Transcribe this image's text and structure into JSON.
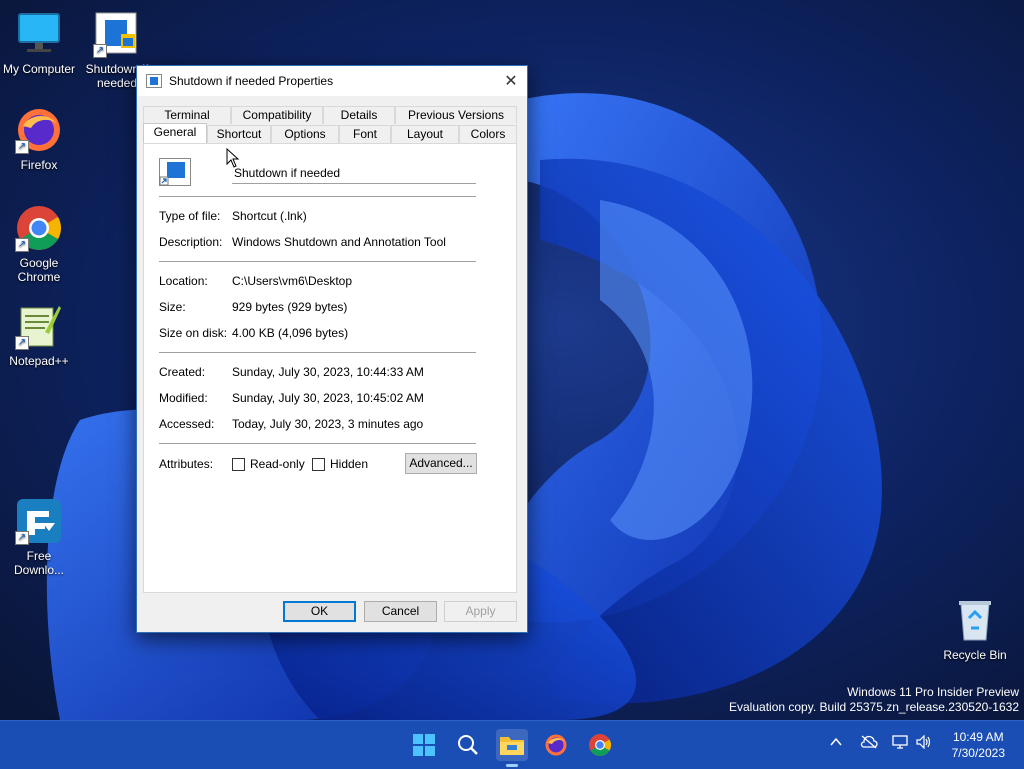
{
  "desktop": {
    "icons": [
      {
        "label": "My Computer",
        "icon": "monitor-icon"
      },
      {
        "label": "Shutdown if needed",
        "icon": "shortcut-app-icon"
      },
      {
        "label": "Firefox",
        "icon": "firefox-icon"
      },
      {
        "label": "Google Chrome",
        "icon": "chrome-icon"
      },
      {
        "label": "Notepad++",
        "icon": "notepadpp-icon"
      },
      {
        "label": "Free Downlo...",
        "icon": "free-download-manager-icon"
      },
      {
        "label": "Recycle Bin",
        "icon": "recycle-bin-icon"
      }
    ],
    "watermark": {
      "line1": "Windows 11 Pro Insider Preview",
      "line2": "Evaluation copy. Build 25375.zn_release.230520-1632"
    }
  },
  "dialog": {
    "title": "Shutdown if needed Properties",
    "close_label": "✕",
    "tabs_back": [
      "Terminal",
      "Compatibility",
      "Details",
      "Previous Versions"
    ],
    "tabs_front": [
      "General",
      "Shortcut",
      "Options",
      "Font",
      "Layout",
      "Colors"
    ],
    "active_tab": "General",
    "name_value": "Shutdown if needed",
    "fields": {
      "type": {
        "label": "Type of file:",
        "value": "Shortcut (.lnk)"
      },
      "description": {
        "label": "Description:",
        "value": "Windows Shutdown and Annotation Tool"
      },
      "location": {
        "label": "Location:",
        "value": "C:\\Users\\vm6\\Desktop"
      },
      "size": {
        "label": "Size:",
        "value": "929 bytes (929 bytes)"
      },
      "size_on_disk": {
        "label": "Size on disk:",
        "value": "4.00 KB (4,096 bytes)"
      },
      "created": {
        "label": "Created:",
        "value": "Sunday, July 30, 2023, 10:44:33 AM"
      },
      "modified": {
        "label": "Modified:",
        "value": "Sunday, July 30, 2023, 10:45:02 AM"
      },
      "accessed": {
        "label": "Accessed:",
        "value": "Today, July 30, 2023, 3 minutes ago"
      }
    },
    "attributes": {
      "label": "Attributes:",
      "readonly": "Read-only",
      "hidden": "Hidden",
      "advanced": "Advanced..."
    },
    "buttons": {
      "ok": "OK",
      "cancel": "Cancel",
      "apply": "Apply"
    }
  },
  "taskbar": {
    "apps": [
      "start-icon",
      "search-icon",
      "file-explorer-icon",
      "firefox-icon",
      "chrome-icon"
    ],
    "time": "10:49 AM",
    "date": "7/30/2023"
  },
  "colors": {
    "accent": "#0078d4",
    "taskbar": "#1b4eb5",
    "dialog_border": "#2f6fb8"
  }
}
